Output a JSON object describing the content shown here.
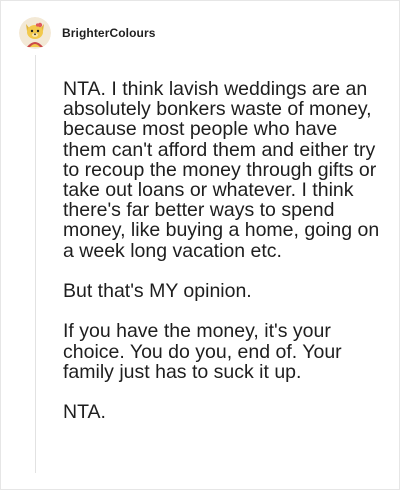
{
  "comment": {
    "username": "BrighterColours",
    "avatar_icon": "cartoon-dog-avatar-icon",
    "paragraphs": [
      "NTA. I think lavish weddings are an absolutely bonkers waste of money, because most people who have them can't afford them and either try to recoup the money through gifts or take out loans or whatever. I think there's far better ways to spend money, like buying a home, going on a week long vacation etc.",
      "But that's MY opinion.",
      "If you have the money, it's your choice. You do you, end of. Your family just has to suck it up.",
      "NTA."
    ]
  }
}
